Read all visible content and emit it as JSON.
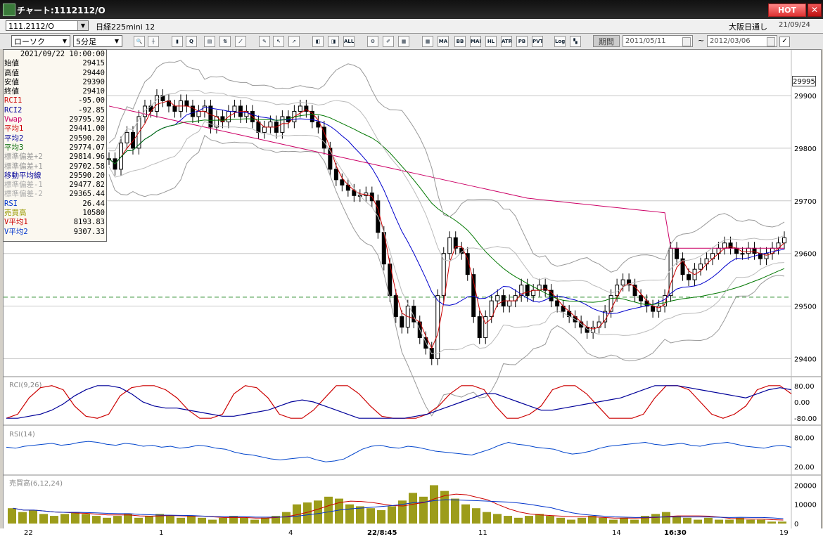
{
  "window": {
    "title": "チャート:1112112/O",
    "hot_label": "HOT",
    "close_label": "✕"
  },
  "symbol_bar": {
    "code": "111.2112/O",
    "name": "日経225mini 12",
    "exchange": "大阪日通し",
    "date": "21/09/24"
  },
  "toolbar": {
    "chart_type": "ローソク",
    "interval": "5分足",
    "period_label": "期間",
    "date_from": "2011/05/11",
    "date_to": "2012/03/06",
    "tilde": "~",
    "check": "✓",
    "buttons": [
      {
        "name": "zoom-icon",
        "glyph": "🔍"
      },
      {
        "name": "crosshair-icon",
        "glyph": "┼"
      },
      {
        "name": "candle-icon",
        "glyph": "▮"
      },
      {
        "name": "search-chart-icon",
        "glyph": "Q"
      },
      {
        "name": "chart-icon",
        "glyph": "▤"
      },
      {
        "name": "updown-icon",
        "glyph": "⇅"
      },
      {
        "name": "ruler-icon",
        "glyph": "⟋"
      },
      {
        "name": "pencil-icon",
        "glyph": "✎"
      },
      {
        "name": "cursor-icon",
        "glyph": "↖"
      },
      {
        "name": "arrow-icon",
        "glyph": "➚"
      },
      {
        "name": "bar-left-icon",
        "glyph": "◧"
      },
      {
        "name": "bar-mid-icon",
        "glyph": "◨"
      },
      {
        "name": "all-icon",
        "glyph": "ALL"
      },
      {
        "name": "settings-icon",
        "glyph": "⚙"
      },
      {
        "name": "tool-icon",
        "glyph": "✐"
      },
      {
        "name": "color-icon",
        "glyph": "▦"
      },
      {
        "name": "table-icon",
        "glyph": "▦"
      },
      {
        "name": "ma-icon",
        "glyph": "MA"
      },
      {
        "name": "bb-icon",
        "glyph": "BB"
      },
      {
        "name": "mae-icon",
        "glyph": "MAE"
      },
      {
        "name": "hl-icon",
        "glyph": "HL"
      },
      {
        "name": "atr-icon",
        "glyph": "ATR"
      },
      {
        "name": "pb-icon",
        "glyph": "PB"
      },
      {
        "name": "pvt-icon",
        "glyph": "PVT"
      },
      {
        "name": "log-icon",
        "glyph": "Log"
      },
      {
        "name": "split-icon",
        "glyph": "▚"
      }
    ]
  },
  "info_panel": {
    "datetime": "2021/09/22  10:00:00",
    "rows": [
      {
        "label": "始値",
        "value": "29415",
        "color": "#000000"
      },
      {
        "label": "高値",
        "value": "29440",
        "color": "#000000"
      },
      {
        "label": "安値",
        "value": "29390",
        "color": "#000000"
      },
      {
        "label": "終値",
        "value": "29410",
        "color": "#000000"
      },
      {
        "label": "RCI1",
        "value": "-95.00",
        "color": "#cc0000"
      },
      {
        "label": "RCI2",
        "value": "-92.85",
        "color": "#000099"
      },
      {
        "label": "Vwap",
        "value": "29795.92",
        "color": "#cc0066"
      },
      {
        "label": "平均1",
        "value": "29441.00",
        "color": "#cc0000"
      },
      {
        "label": "平均2",
        "value": "29590.20",
        "color": "#000099"
      },
      {
        "label": "平均3",
        "value": "29774.07",
        "color": "#006600"
      },
      {
        "label": "標準偏差+2",
        "value": "29814.96",
        "color": "#999999"
      },
      {
        "label": "標準偏差+1",
        "value": "29702.58",
        "color": "#999999"
      },
      {
        "label": "移動平均線",
        "value": "29590.20",
        "color": "#000099"
      },
      {
        "label": "標準偏差-1",
        "value": "29477.82",
        "color": "#aaaaaa"
      },
      {
        "label": "標準偏差-2",
        "value": "29365.44",
        "color": "#aaaaaa"
      },
      {
        "label": "RSI",
        "value": "26.44",
        "color": "#0033cc"
      },
      {
        "label": "売買高",
        "value": "10580",
        "color": "#999900"
      },
      {
        "label": "V平均1",
        "value": "8193.83",
        "color": "#cc0000"
      },
      {
        "label": "V平均2",
        "value": "9307.33",
        "color": "#0033cc"
      }
    ]
  },
  "price_axis": {
    "current": "29995",
    "ticks": [
      "29900",
      "29800",
      "29700",
      "29600",
      "29500",
      "29400"
    ]
  },
  "rci_panel": {
    "label": "RCI(9,26)",
    "ticks": [
      "80.00",
      "0.00",
      "-80.00"
    ]
  },
  "rsi_panel": {
    "label": "RSI(14)",
    "ticks": [
      "80.00",
      "20.00"
    ]
  },
  "volume_panel": {
    "label": "売買高(6,12,24)",
    "ticks": [
      "20000",
      "10000",
      "0"
    ]
  },
  "x_axis": {
    "labels": [
      {
        "text": "22",
        "bold": false
      },
      {
        "text": "1",
        "bold": false
      },
      {
        "text": "4",
        "bold": false
      },
      {
        "text": "22/8:45",
        "bold": true
      },
      {
        "text": "11",
        "bold": false
      },
      {
        "text": "14",
        "bold": false
      },
      {
        "text": "16:30",
        "bold": true
      },
      {
        "text": "19",
        "bold": false
      }
    ]
  },
  "colors": {
    "up": "#000000",
    "down": "#000000",
    "ma1": "#cc0000",
    "ma2": "#0000cc",
    "ma3": "#007700",
    "vwap": "#cc0066",
    "bb": "#999999"
  },
  "chart_data": {
    "type": "candlestick",
    "ylim": [
      29370,
      29960
    ],
    "close": [
      29780,
      29760,
      29810,
      29830,
      29800,
      29860,
      29880,
      29870,
      29900,
      29890,
      29880,
      29870,
      29890,
      29880,
      29860,
      29870,
      29880,
      29840,
      29860,
      29850,
      29870,
      29880,
      29860,
      29870,
      29850,
      29830,
      29840,
      29850,
      29830,
      29860,
      29850,
      29870,
      29880,
      29870,
      29850,
      29840,
      29800,
      29760,
      29740,
      29730,
      29720,
      29710,
      29710,
      29715,
      29700,
      29640,
      29580,
      29520,
      29480,
      29460,
      29500,
      29470,
      29440,
      29420,
      29400,
      29520,
      29600,
      29630,
      29610,
      29600,
      29560,
      29480,
      29440,
      29480,
      29510,
      29520,
      29500,
      29510,
      29520,
      29540,
      29520,
      29530,
      29540,
      29530,
      29510,
      29500,
      29490,
      29480,
      29470,
      29460,
      29450,
      29460,
      29470,
      29490,
      29520,
      29540,
      29550,
      29540,
      29520,
      29510,
      29500,
      29490,
      29500,
      29520,
      29610,
      29590,
      29560,
      29550,
      29570,
      29580,
      29590,
      29600,
      29610,
      29620,
      29610,
      29600,
      29600,
      29610,
      29600,
      29590,
      29600,
      29610,
      29620,
      29630
    ],
    "series": [
      {
        "name": "平均1"
      },
      {
        "name": "平均2"
      },
      {
        "name": "平均3"
      },
      {
        "name": "Vwap"
      },
      {
        "name": "標準偏差+2"
      },
      {
        "name": "標準偏差-2"
      }
    ],
    "rci": {
      "fast": [
        -80,
        -60,
        20,
        70,
        80,
        60,
        -20,
        -70,
        -80,
        -60,
        30,
        70,
        80,
        80,
        60,
        20,
        -40,
        -80,
        -80,
        -60,
        40,
        80,
        70,
        20,
        -60,
        -80,
        -80,
        -40,
        20,
        80,
        80,
        40,
        -20,
        -70,
        -80,
        -80,
        -80,
        -60,
        -20,
        40,
        80,
        80,
        60,
        -20,
        -80,
        -80,
        -60,
        -20,
        60,
        80,
        80,
        40,
        -20,
        -80,
        -80,
        -80,
        -60,
        20,
        80,
        80,
        60,
        0,
        -60,
        -80,
        -60,
        -20,
        60,
        80,
        80,
        40
      ],
      "slow": [
        -80,
        -80,
        -70,
        -60,
        -40,
        -10,
        30,
        60,
        80,
        80,
        70,
        40,
        0,
        -20,
        -30,
        -30,
        -40,
        -50,
        -60,
        -70,
        -70,
        -60,
        -50,
        -40,
        -20,
        0,
        10,
        0,
        -20,
        -40,
        -60,
        -80,
        -80,
        -80,
        -80,
        -80,
        -70,
        -60,
        -40,
        -20,
        0,
        20,
        40,
        40,
        20,
        0,
        -20,
        -40,
        -40,
        -30,
        -20,
        -10,
        0,
        10,
        20,
        40,
        60,
        80,
        80,
        80,
        70,
        60,
        50,
        40,
        30,
        20,
        40,
        60,
        70,
        60
      ]
    },
    "rsi": [
      60,
      58,
      62,
      64,
      66,
      68,
      64,
      66,
      70,
      72,
      70,
      66,
      64,
      68,
      66,
      62,
      64,
      60,
      62,
      58,
      60,
      64,
      62,
      58,
      56,
      50,
      46,
      44,
      40,
      36,
      34,
      36,
      38,
      40,
      34,
      30,
      32,
      36,
      46,
      56,
      62,
      64,
      60,
      58,
      62,
      60,
      56,
      52,
      50,
      48,
      46,
      44,
      50,
      56,
      64,
      70,
      66,
      64,
      60,
      58,
      56,
      50,
      46,
      48,
      52,
      58,
      62,
      64,
      66,
      68,
      70,
      66,
      64,
      66,
      68,
      64,
      62,
      66,
      68,
      70,
      66,
      62,
      60,
      58,
      62,
      64,
      60
    ],
    "volume": [
      8000,
      6000,
      7000,
      5000,
      4000,
      5000,
      6000,
      5000,
      4000,
      3000,
      4000,
      5000,
      3000,
      4000,
      5000,
      4000,
      3000,
      4000,
      3000,
      2000,
      3000,
      4000,
      3000,
      2000,
      3000,
      4000,
      6000,
      10000,
      11000,
      12000,
      14000,
      13000,
      10000,
      9000,
      8000,
      7000,
      9000,
      12000,
      16000,
      14000,
      20000,
      17000,
      13000,
      10000,
      8000,
      6000,
      5000,
      4000,
      3000,
      4000,
      5000,
      4000,
      3000,
      2000,
      3000,
      4000,
      3000,
      2000,
      3000,
      2000,
      4000,
      5000,
      6000,
      4000,
      3000,
      2000,
      3000,
      2000,
      2000,
      3000,
      2000,
      2000,
      1000,
      1000
    ]
  }
}
